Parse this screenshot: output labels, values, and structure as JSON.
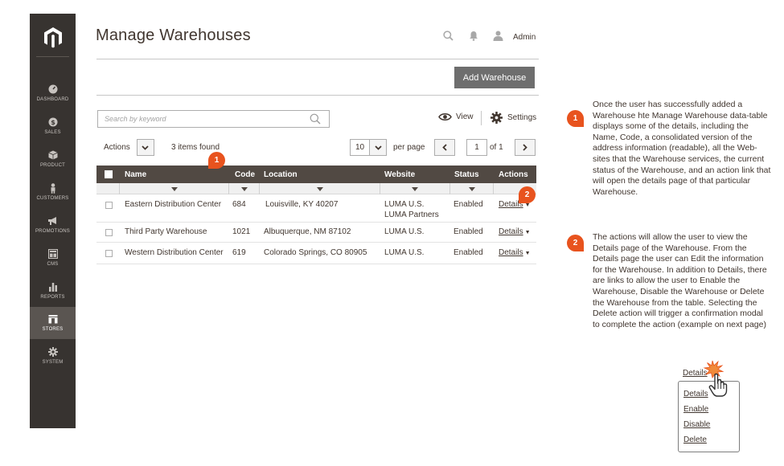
{
  "sidebar": {
    "items": [
      {
        "label": "DASHBOARD",
        "icon": "dashboard-gauge-icon"
      },
      {
        "label": "SALES",
        "icon": "dollar-icon"
      },
      {
        "label": "PRODUCT",
        "icon": "cube-icon"
      },
      {
        "label": "CUSTOMERS",
        "icon": "person-icon"
      },
      {
        "label": "PROMOTIONS",
        "icon": "megaphone-icon"
      },
      {
        "label": "CMS",
        "icon": "layout-icon"
      },
      {
        "label": "REPORTS",
        "icon": "bar-chart-icon"
      },
      {
        "label": "STORES",
        "icon": "store-icon"
      },
      {
        "label": "SYSTEM",
        "icon": "gear-icon"
      }
    ],
    "active": "STORES"
  },
  "header": {
    "title": "Manage Warehouses",
    "user": "Admin"
  },
  "toolbar": {
    "add_button": "Add Warehouse",
    "search_placeholder": "Search by keyword",
    "view_label": "View",
    "settings_label": "Settings",
    "actions_label": "Actions",
    "found_text": "3 items found",
    "per_page_value": "10",
    "per_page_label": "per page",
    "page_current": "1",
    "page_total_text": "of 1"
  },
  "grid": {
    "columns": [
      "Name",
      "Code",
      "Location",
      "Website",
      "Status",
      "Actions"
    ],
    "rows": [
      {
        "name": "Eastern Distribution Center",
        "code": "684",
        "location": "Louisville, KY 40207",
        "website": [
          "LUMA U.S.",
          "LUMA Partners"
        ],
        "status": "Enabled",
        "action": "Details"
      },
      {
        "name": "Third Party Warehouse",
        "code": "1021",
        "location": "Albuquerque, NM 87102",
        "website": [
          "LUMA U.S."
        ],
        "status": "Enabled",
        "action": "Details"
      },
      {
        "name": "Western Distribution Center",
        "code": "619",
        "location": "Colorado Springs, CO 80905",
        "website": [
          "LUMA U.S."
        ],
        "status": "Enabled",
        "action": "Details"
      }
    ]
  },
  "badges": [
    "1",
    "2"
  ],
  "notes": [
    {
      "number": "1",
      "text": "Once the user has successfully added a Warehouse hte Manage Warehouse data-table displays some of the details, including the Name, Code, a consolidated version of the address information (readable), all the Web-sites that the Warehouse services, the current status of the Warehouse, and an action link that will open the details page of that particular Warehouse."
    },
    {
      "number": "2",
      "text": "The actions will allow the user to view the Details page of the Warehouse. From the Details page the user can Edit the information for the Warehouse. In addition to Details, there are links to allow the user to Enable the Warehouse, Disable the Warehouse or Delete the Warehouse from the table. Selecting  the Delete action will trigger a confirmation modal to complete the action (example on next page)"
    }
  ],
  "action_menu": {
    "trigger": "Details",
    "items": [
      "Details",
      "Enable",
      "Disable",
      "Delete"
    ]
  },
  "colors": {
    "sidebar_bg": "#373330",
    "sidebar_active": "#5a5551",
    "grid_header": "#514943",
    "badge": "#e8531e",
    "button": "#6e6e6e"
  }
}
